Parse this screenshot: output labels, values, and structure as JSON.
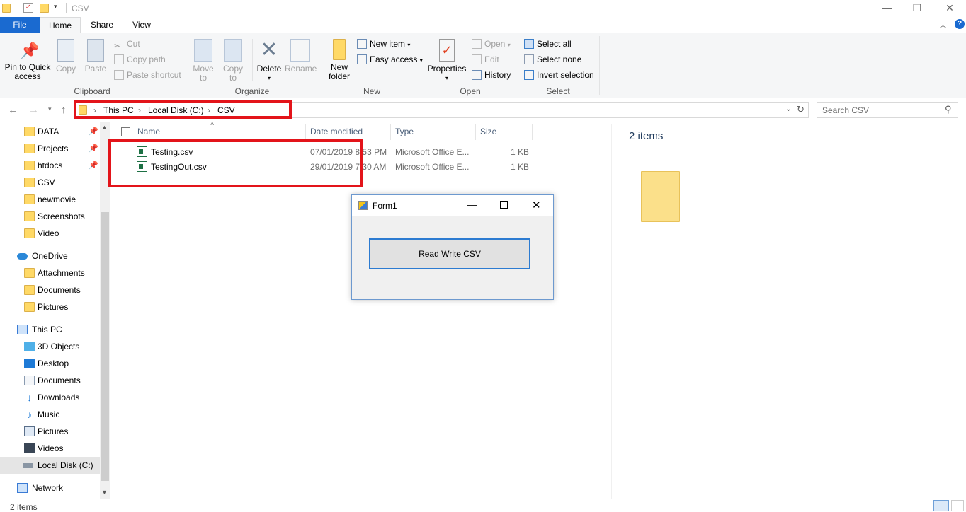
{
  "window": {
    "title": "CSV"
  },
  "tabs": {
    "file": "File",
    "home": "Home",
    "share": "Share",
    "view": "View"
  },
  "ribbon": {
    "clipboard": {
      "label": "Clipboard",
      "pin": "Pin to Quick",
      "pin2": "access",
      "copy": "Copy",
      "paste": "Paste",
      "cut": "Cut",
      "copy_path": "Copy path",
      "paste_shortcut": "Paste shortcut"
    },
    "organize": {
      "label": "Organize",
      "move": "Move",
      "move2": "to",
      "copy": "Copy",
      "copy2": "to",
      "delete": "Delete",
      "rename": "Rename"
    },
    "new": {
      "label": "New",
      "new_folder": "New",
      "new_folder2": "folder",
      "new_item": "New item",
      "easy_access": "Easy access"
    },
    "open": {
      "label": "Open",
      "properties": "Properties",
      "open": "Open",
      "edit": "Edit",
      "history": "History"
    },
    "select": {
      "label": "Select",
      "select_all": "Select all",
      "select_none": "Select none",
      "invert": "Invert selection"
    }
  },
  "address": {
    "crumbs": [
      "This PC",
      "Local Disk (C:)",
      "CSV"
    ],
    "search_placeholder": "Search CSV"
  },
  "nav": {
    "quick": [
      "DATA",
      "Projects",
      "htdocs",
      "CSV",
      "newmovie",
      "Screenshots",
      "Video"
    ],
    "onedrive": "OneDrive",
    "onedrive_items": [
      "Attachments",
      "Documents",
      "Pictures"
    ],
    "thispc": "This PC",
    "thispc_items": [
      "3D Objects",
      "Desktop",
      "Documents",
      "Downloads",
      "Music",
      "Pictures",
      "Videos",
      "Local Disk (C:)"
    ],
    "network": "Network"
  },
  "columns": {
    "name": "Name",
    "date": "Date modified",
    "type": "Type",
    "size": "Size"
  },
  "files": [
    {
      "name": "Testing.csv",
      "date": "07/01/2019 8:53 PM",
      "type": "Microsoft Office E...",
      "size": "1 KB"
    },
    {
      "name": "TestingOut.csv",
      "date": "29/01/2019 7:30 AM",
      "type": "Microsoft Office E...",
      "size": "1 KB"
    }
  ],
  "preview": {
    "count": "2 items"
  },
  "form": {
    "title": "Form1",
    "button": "Read  Write CSV"
  },
  "status": {
    "count": "2 items"
  },
  "colors": {
    "accent": "#1a6ad0",
    "highlight": "#e3141a",
    "folder": "#ffd966"
  }
}
